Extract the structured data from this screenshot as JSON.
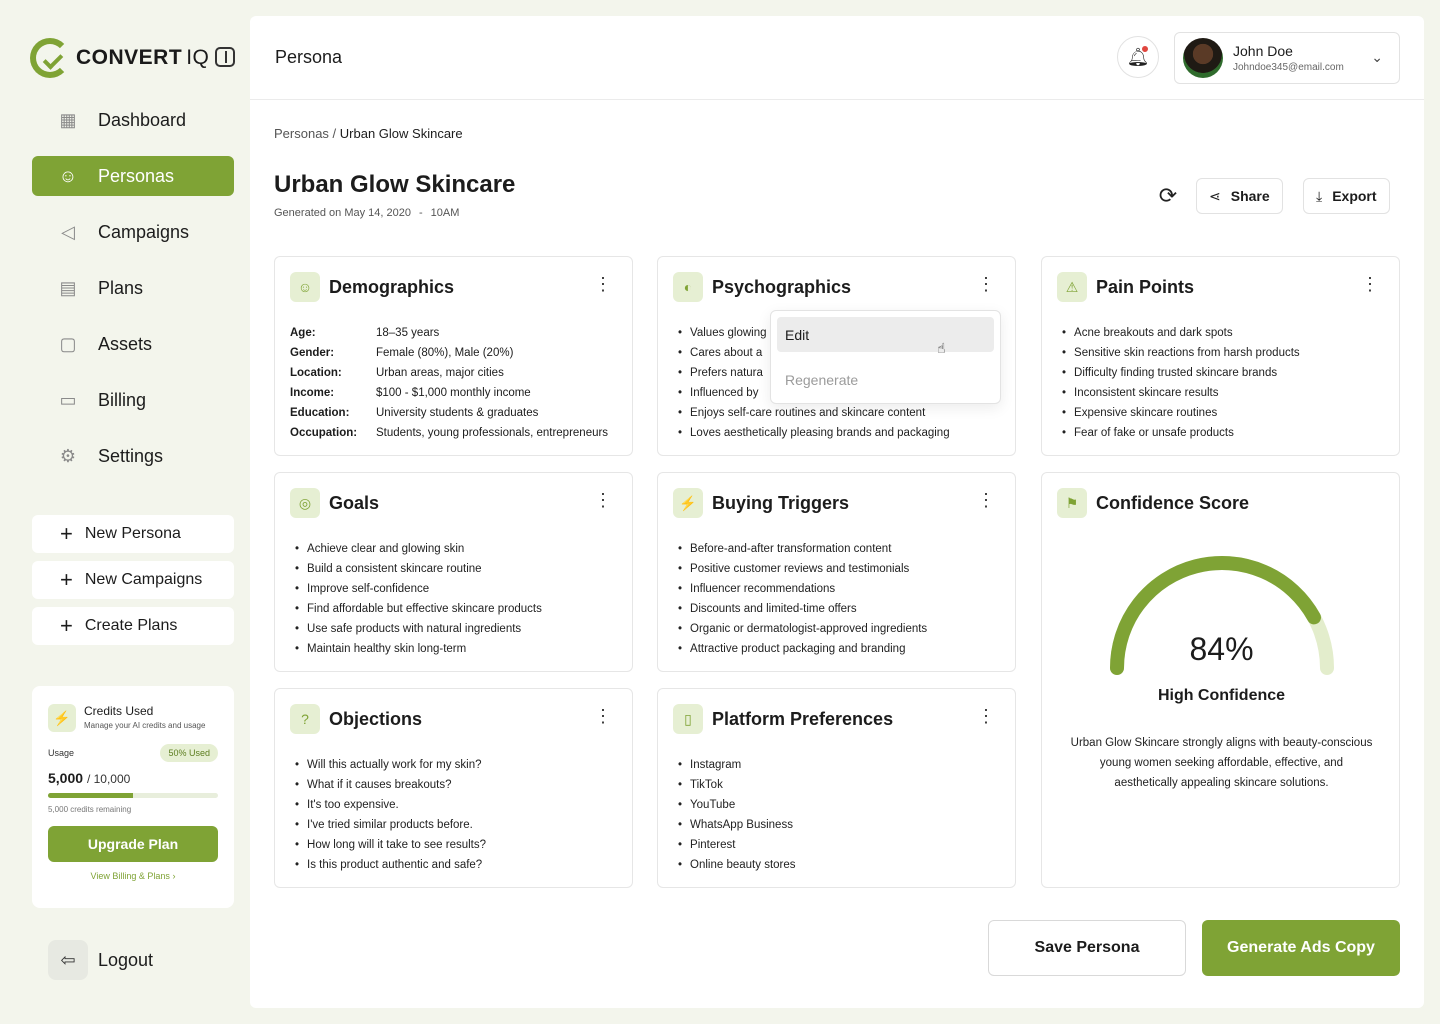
{
  "brand": {
    "name": "CONVERT",
    "suffix": "IQ"
  },
  "nav": [
    {
      "label": "Dashboard",
      "icon": "grid-icon",
      "glyph": "▦"
    },
    {
      "label": "Personas",
      "icon": "users-icon",
      "glyph": "☺"
    },
    {
      "label": "Campaigns",
      "icon": "megaphone-icon",
      "glyph": "◁"
    },
    {
      "label": "Plans",
      "icon": "clipboard-icon",
      "glyph": "▤"
    },
    {
      "label": "Assets",
      "icon": "folder-icon",
      "glyph": "▢"
    },
    {
      "label": "Billing",
      "icon": "card-icon",
      "glyph": "▭"
    },
    {
      "label": "Settings",
      "icon": "gear-icon",
      "glyph": "⚙"
    }
  ],
  "quick": [
    "New Persona",
    "New Campaigns",
    "Create Plans"
  ],
  "credits": {
    "title": "Credits Used",
    "subtitle": "Manage your AI credits and usage",
    "usage_label": "Usage",
    "badge": "50% Used",
    "used": "5,000",
    "total": "/ 10,000",
    "progress": 0.5,
    "remaining": "5,000 credits remaining",
    "upgrade": "Upgrade Plan",
    "billing_link": "View Billing & Plans"
  },
  "logout": "Logout",
  "topbar": {
    "title": "Persona"
  },
  "user": {
    "name": "John Doe",
    "email": "Johndoe345@email.com"
  },
  "breadcrumb": {
    "parent": "Personas /",
    "current": "Urban Glow Skincare"
  },
  "page": {
    "title": "Urban Glow Skincare",
    "generated": "Generated on May 14, 2020",
    "sep": "-",
    "time": "10AM"
  },
  "actions": {
    "share": "Share",
    "export": "Export"
  },
  "demographics": {
    "title": "Demographics",
    "rows": [
      {
        "k": "Age:",
        "v": "18–35 years"
      },
      {
        "k": "Gender:",
        "v": "Female (80%), Male (20%)"
      },
      {
        "k": "Location:",
        "v": "Urban areas, major cities"
      },
      {
        "k": "Income:",
        "v": "$100 - $1,000 monthly income"
      },
      {
        "k": "Education:",
        "v": "University students & graduates"
      },
      {
        "k": "Occupation:",
        "v": "Students, young professionals, entrepreneurs"
      }
    ]
  },
  "psychographics": {
    "title": "Psychographics",
    "items": [
      "Values glowing",
      "Cares about a",
      "Prefers natura",
      "Influenced by",
      "Enjoys self-care routines and skincare content",
      "Loves aesthetically pleasing brands and packaging"
    ]
  },
  "menu": {
    "edit": "Edit",
    "regenerate": "Regenerate"
  },
  "pain_points": {
    "title": "Pain Points",
    "items": [
      "Acne breakouts and dark spots",
      "Sensitive skin reactions from harsh products",
      "Difficulty finding trusted skincare brands",
      "Inconsistent skincare results",
      "Expensive skincare routines",
      "Fear of fake or unsafe products"
    ]
  },
  "goals": {
    "title": "Goals",
    "items": [
      "Achieve clear and glowing skin",
      "Build a consistent skincare routine",
      "Improve self-confidence",
      "Find affordable but effective skincare products",
      "Use safe products with natural ingredients",
      "Maintain healthy skin long-term"
    ]
  },
  "buying_triggers": {
    "title": "Buying Triggers",
    "items": [
      "Before-and-after transformation content",
      "Positive customer reviews and testimonials",
      "Influencer recommendations",
      "Discounts and limited-time offers",
      "Organic or dermatologist-approved ingredients",
      "Attractive product packaging and branding"
    ]
  },
  "objections": {
    "title": "Objections",
    "items": [
      "Will this actually work for my skin?",
      "What if it causes breakouts?",
      "It's too expensive.",
      "I've tried similar products before.",
      "How long will it take to see results?",
      "Is this product authentic and safe?"
    ]
  },
  "platforms": {
    "title": "Platform Preferences",
    "items": [
      "Instagram",
      "TikTok",
      "YouTube",
      "WhatsApp Business",
      "Pinterest",
      "Online beauty stores"
    ]
  },
  "confidence": {
    "title": "Confidence Score",
    "value_text": "84%",
    "value": 84,
    "label": "High Confidence",
    "description": "Urban Glow Skincare strongly aligns with beauty-conscious young women seeking affordable, effective, and aesthetically appealing skincare solutions."
  },
  "footer": {
    "save": "Save Persona",
    "generate": "Generate Ads Copy"
  },
  "colors": {
    "accent": "#7fa335",
    "accent_light": "#e6efd3"
  }
}
